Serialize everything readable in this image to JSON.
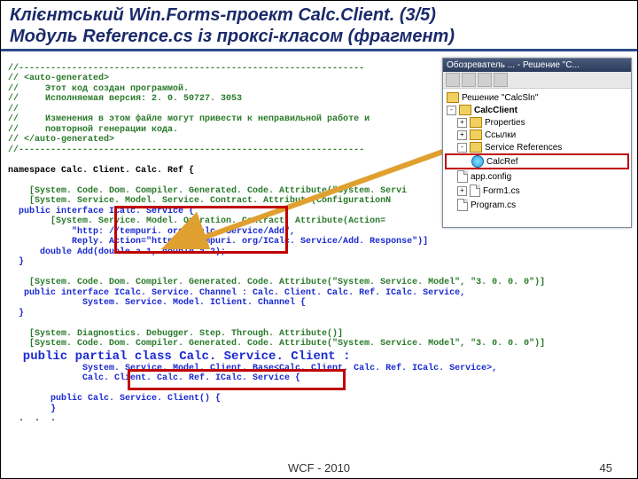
{
  "title": {
    "line1a": "Клієнтський ",
    "line1b": "Win.Forms",
    "line1c": "-проект ",
    "line1d": "Calc.Client.",
    "line1e": " (3/5)",
    "line2a": "Модуль ",
    "line2b": "Reference.cs",
    "line2c": " із проксі-класом (фрагмент)"
  },
  "code": {
    "c01": "//-----------------------------------------------------------------",
    "c02": "// <auto-generated>",
    "c03": "//     Этот код создан программой.",
    "c04": "//     Исполняемая версия: 2. 0. 50727. 3053",
    "c05": "//",
    "c06": "//     Изменения в этом файле могут привести к неправильной работе и",
    "c07": "//     повторной генерации кода.",
    "c08": "// </auto-generated>",
    "c09": "//-----------------------------------------------------------------",
    "c10": "",
    "ns": "namespace Calc. Client. Calc. Ref {",
    "c11": "",
    "a1": "    [System. Code. Dom. Compiler. Generated. Code. Attribute(\"System. Servi",
    "a2": "    [System. Service. Model. Service. Contract. Attribute(ConfigurationN",
    "i1a": "  public interface ",
    "i1b": "ICalc. Service",
    "i1c": " {",
    "a3": "        [System. Service. Model. Operation. Contract. Attribute(Action=",
    "s1": "            \"http: //tempuri. org/ICalc. Service/Add\",",
    "s2": "            Reply. Action=\"http: //tempuri. org/ICalc. Service/Add. Response\")]",
    "m1": "      double Add(double a 1, double a 2);",
    "b1": "  }",
    "c12": "",
    "a4": "    [System. Code. Dom. Compiler. Generated. Code. Attribute(\"System. Service. Model\", \"3. 0. 0. 0\")]",
    "i2": "   public interface ICalc. Service. Channel : Calc. Client. Calc. Ref. ICalc. Service,",
    "i2b": "              System. Service. Model. IClient. Channel {",
    "b2": "  }",
    "c13": "",
    "a5": "    [System. Diagnostics. Debugger. Step. Through. Attribute()]",
    "a6": "    [System. Code. Dom. Compiler. Generated. Code. Attribute(\"System. Service. Model\", \"3. 0. 0. 0\")]",
    "cl1a": "  public partial ",
    "cl1b": "class Calc. Service. Client",
    "cl1c": " :",
    "cl2": "              System. Service. Model. Client. Base<Calc. Client. Calc. Ref. ICalc. Service>,",
    "cl3": "              Calc. Client. Calc. Ref. ICalc. Service {",
    "c14": "",
    "ct1": "        public Calc. Service. Client() {",
    "ct2": "        }",
    "el": "  .  .  ."
  },
  "explorer": {
    "title": "Обозреватель ... - Решение \"C...",
    "root": "Решение \"CalcSln\"",
    "proj": "CalcClient",
    "props": "Properties",
    "refs": "Ссылки",
    "srefs": "Service References",
    "calcref": "CalcRef",
    "appcfg": "app.config",
    "form": "Form1.cs",
    "prog": "Program.cs"
  },
  "footer": {
    "center": "WCF  - 2010",
    "page": "45"
  }
}
